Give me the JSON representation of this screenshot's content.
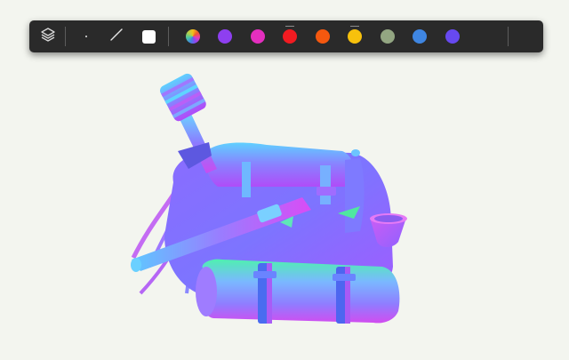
{
  "toolbar": {
    "tools": [
      {
        "name": "layers-icon"
      },
      {
        "name": "point-tool-icon"
      },
      {
        "name": "line-tool-icon"
      },
      {
        "name": "square-tool-icon"
      }
    ],
    "colors": [
      {
        "name": "multicolor",
        "value": "conic"
      },
      {
        "name": "purple",
        "value": "#8e3ff0"
      },
      {
        "name": "magenta",
        "value": "#e42fbf"
      },
      {
        "name": "red",
        "value": "#f21b21"
      },
      {
        "name": "orange",
        "value": "#f5580f"
      },
      {
        "name": "yellow",
        "value": "#f7c10c"
      },
      {
        "name": "sage",
        "value": "#93a682"
      },
      {
        "name": "blue",
        "value": "#3f86e2"
      },
      {
        "name": "indigo",
        "value": "#6749f0"
      }
    ]
  },
  "canvas": {
    "background": "#f3f5ef",
    "model": "normal-map-render-of-backpack-with-horn-and-bedroll"
  }
}
